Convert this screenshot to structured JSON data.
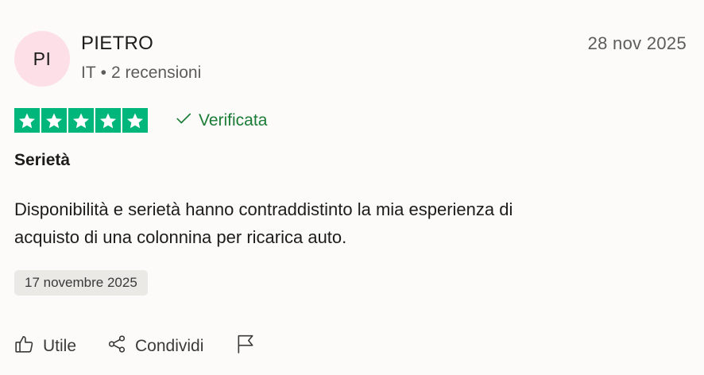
{
  "reviewer": {
    "initials": "PI",
    "name": "PIETRO",
    "country": "IT",
    "separator": "•",
    "review_count": "2 recensioni"
  },
  "review": {
    "date": "28 nov 2025",
    "rating": 5,
    "verified_label": "Verificata",
    "title": "Serietà",
    "body_line1": "Disponibilità e serietà hanno contraddistinto la mia esperienza di",
    "body_line2": "acquisto di una colonnina per ricarica auto.",
    "experience_date": "17 novembre 2025"
  },
  "actions": {
    "useful_label": "Utile",
    "share_label": "Condividi"
  },
  "icons": {
    "star": "star-icon",
    "verified": "checkmark-icon",
    "useful": "thumbs-up-icon",
    "share": "share-icon",
    "report": "flag-icon"
  },
  "colors": {
    "star_green": "#00b67a",
    "verified_green": "#1a7c36",
    "avatar_bg": "#fde0e7"
  }
}
